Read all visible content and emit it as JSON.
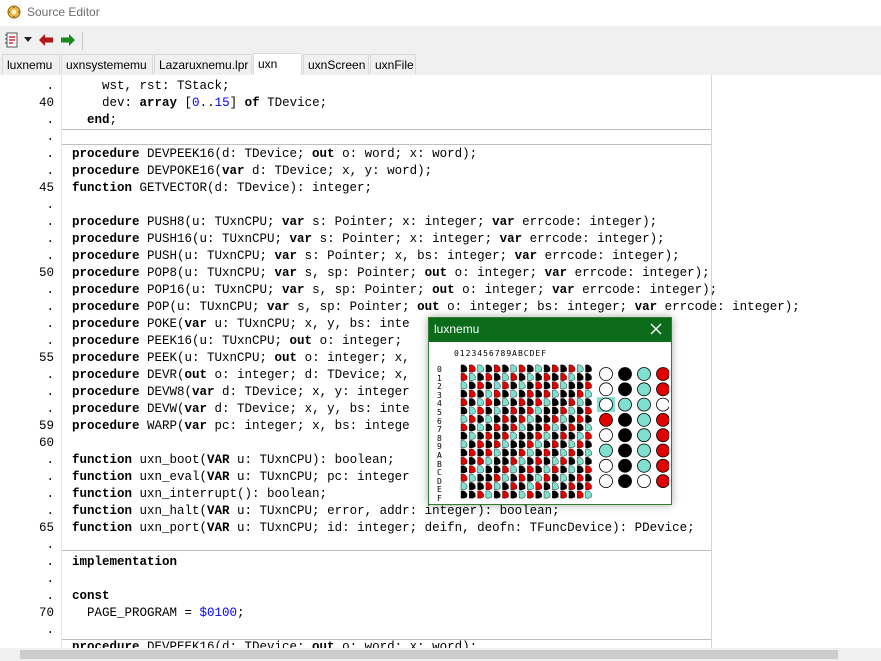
{
  "window": {
    "title": "Source Editor"
  },
  "toolbar": {
    "items": [
      "file-options-icon",
      "dropdown-icon",
      "back-icon",
      "forward-icon"
    ]
  },
  "tabs": [
    "luxnemu",
    "uxnsystememu",
    "Lazaruxnemu.lpr",
    "uxn",
    "uxnScreen",
    "uxnFile"
  ],
  "active_tab": "uxn",
  "editor": {
    "lines": [
      {
        "n": ".",
        "code": [
          [
            "    wst, rst: TStack;",
            ""
          ]
        ]
      },
      {
        "n": "40",
        "code": [
          [
            "    dev: ",
            ""
          ],
          [
            "array",
            "kw"
          ],
          [
            " [",
            ""
          ],
          [
            "0",
            "num"
          ],
          [
            "..",
            ""
          ],
          [
            "15",
            "num"
          ],
          [
            "] ",
            ""
          ],
          [
            "of",
            "kw"
          ],
          [
            " TDevice;",
            ""
          ]
        ]
      },
      {
        "n": ".",
        "code": [
          [
            "  ",
            ""
          ],
          [
            "end",
            "kw"
          ],
          [
            ";",
            ""
          ]
        ]
      },
      {
        "n": ".",
        "code": []
      },
      {
        "n": ".",
        "code": [
          [
            "procedure",
            "kw"
          ],
          [
            " DEVPEEK16(d: TDevice; ",
            ""
          ],
          [
            "out",
            "kw"
          ],
          [
            " o: word; x: word);",
            ""
          ]
        ]
      },
      {
        "n": ".",
        "code": [
          [
            "procedure",
            "kw"
          ],
          [
            " DEVPOKE16(",
            ""
          ],
          [
            "var",
            "kw"
          ],
          [
            " d: TDevice; x, y: word);",
            ""
          ]
        ]
      },
      {
        "n": "45",
        "code": [
          [
            "function",
            "kw"
          ],
          [
            " GETVECTOR(d: TDevice): integer;",
            ""
          ]
        ]
      },
      {
        "n": ".",
        "code": []
      },
      {
        "n": ".",
        "code": [
          [
            "procedure",
            "kw"
          ],
          [
            " PUSH8(u: TUxnCPU; ",
            ""
          ],
          [
            "var",
            "kw"
          ],
          [
            " s: Pointer; x: integer; ",
            ""
          ],
          [
            "var",
            "kw"
          ],
          [
            " errcode: integer);",
            ""
          ]
        ]
      },
      {
        "n": ".",
        "code": [
          [
            "procedure",
            "kw"
          ],
          [
            " PUSH16(u: TUxnCPU; ",
            ""
          ],
          [
            "var",
            "kw"
          ],
          [
            " s: Pointer; x: integer; ",
            ""
          ],
          [
            "var",
            "kw"
          ],
          [
            " errcode: integer);",
            ""
          ]
        ]
      },
      {
        "n": ".",
        "code": [
          [
            "procedure",
            "kw"
          ],
          [
            " PUSH(u: TUxnCPU; ",
            ""
          ],
          [
            "var",
            "kw"
          ],
          [
            " s: Pointer; x, bs: integer; ",
            ""
          ],
          [
            "var",
            "kw"
          ],
          [
            " errcode: integer);",
            ""
          ]
        ]
      },
      {
        "n": "50",
        "code": [
          [
            "procedure",
            "kw"
          ],
          [
            " POP8(u: TUxnCPU; ",
            ""
          ],
          [
            "var",
            "kw"
          ],
          [
            " s, sp: Pointer; ",
            ""
          ],
          [
            "out",
            "kw"
          ],
          [
            " o: integer; ",
            ""
          ],
          [
            "var",
            "kw"
          ],
          [
            " errcode: integer);",
            ""
          ]
        ]
      },
      {
        "n": ".",
        "code": [
          [
            "procedure",
            "kw"
          ],
          [
            " POP16(u: TUxnCPU; ",
            ""
          ],
          [
            "var",
            "kw"
          ],
          [
            " s, sp: Pointer; ",
            ""
          ],
          [
            "out",
            "kw"
          ],
          [
            " o: integer; ",
            ""
          ],
          [
            "var",
            "kw"
          ],
          [
            " errcode: integer);",
            ""
          ]
        ]
      },
      {
        "n": ".",
        "code": [
          [
            "procedure",
            "kw"
          ],
          [
            " POP(u: TUxnCPU; ",
            ""
          ],
          [
            "var",
            "kw"
          ],
          [
            " s, sp: Pointer; ",
            ""
          ],
          [
            "out",
            "kw"
          ],
          [
            " o: integer; bs: integer; ",
            ""
          ],
          [
            "var",
            "kw"
          ],
          [
            " errcode: integer);",
            ""
          ]
        ]
      },
      {
        "n": ".",
        "code": [
          [
            "procedure",
            "kw"
          ],
          [
            " POKE(",
            ""
          ],
          [
            "var",
            "kw"
          ],
          [
            " u: TUxnCPU; x, y, bs: inte",
            ""
          ]
        ]
      },
      {
        "n": ".",
        "code": [
          [
            "procedure",
            "kw"
          ],
          [
            " PEEK16(u: TUxnCPU; ",
            ""
          ],
          [
            "out",
            "kw"
          ],
          [
            " o: integer;",
            ""
          ]
        ]
      },
      {
        "n": "55",
        "code": [
          [
            "procedure",
            "kw"
          ],
          [
            " PEEK(u: TUxnCPU; ",
            ""
          ],
          [
            "out",
            "kw"
          ],
          [
            " o: integer; x,",
            ""
          ]
        ]
      },
      {
        "n": ".",
        "code": [
          [
            "procedure",
            "kw"
          ],
          [
            " DEVR(",
            ""
          ],
          [
            "out",
            "kw"
          ],
          [
            " o: integer; d: TDevice; x,",
            ""
          ]
        ]
      },
      {
        "n": ".",
        "code": [
          [
            "procedure",
            "kw"
          ],
          [
            " DEVW8(",
            ""
          ],
          [
            "var",
            "kw"
          ],
          [
            " d: TDevice; x, y: integer",
            ""
          ]
        ]
      },
      {
        "n": ".",
        "code": [
          [
            "procedure",
            "kw"
          ],
          [
            " DEVW(",
            ""
          ],
          [
            "var",
            "kw"
          ],
          [
            " d: TDevice; x, y, bs: inte",
            ""
          ]
        ]
      },
      {
        "n": "59",
        "code": [
          [
            "procedure",
            "kw"
          ],
          [
            " WARP(",
            ""
          ],
          [
            "var",
            "kw"
          ],
          [
            " pc: integer; x, bs: intege",
            ""
          ]
        ]
      },
      {
        "n": "60",
        "code": []
      },
      {
        "n": ".",
        "code": [
          [
            "function",
            "kw"
          ],
          [
            " uxn_boot(",
            ""
          ],
          [
            "VAR",
            "kw"
          ],
          [
            " u: TUxnCPU): boolean;",
            ""
          ]
        ]
      },
      {
        "n": ".",
        "code": [
          [
            "function",
            "kw"
          ],
          [
            " uxn_eval(",
            ""
          ],
          [
            "VAR",
            "kw"
          ],
          [
            " u: TUxnCPU; pc: integer",
            ""
          ]
        ]
      },
      {
        "n": ".",
        "code": [
          [
            "function",
            "kw"
          ],
          [
            " uxn_interrupt(): boolean;",
            ""
          ]
        ]
      },
      {
        "n": ".",
        "code": [
          [
            "function",
            "kw"
          ],
          [
            " uxn_halt(",
            ""
          ],
          [
            "VAR",
            "kw"
          ],
          [
            " u: TUxnCPU; error, addr: integer): boolean;",
            ""
          ]
        ]
      },
      {
        "n": "65",
        "code": [
          [
            "function",
            "kw"
          ],
          [
            " uxn_port(",
            ""
          ],
          [
            "VAR",
            "kw"
          ],
          [
            " u: TUxnCPU; id: integer; deifn, deofn: TFuncDevice): PDevice;",
            ""
          ]
        ]
      },
      {
        "n": ".",
        "code": []
      },
      {
        "n": ".",
        "code": [
          [
            "implementation",
            "kw"
          ]
        ]
      },
      {
        "n": ".",
        "code": []
      },
      {
        "n": ".",
        "code": [
          [
            "const",
            "kw"
          ]
        ]
      },
      {
        "n": "70",
        "code": [
          [
            "  PAGE_PROGRAM = ",
            ""
          ],
          [
            "$0100",
            "num"
          ],
          [
            ";",
            ""
          ]
        ]
      },
      {
        "n": ".",
        "code": []
      },
      {
        "n": ".",
        "code": [
          [
            "procedure",
            "kw"
          ],
          [
            " DEVPEEK16(d: TDevice; ",
            ""
          ],
          [
            "out",
            "kw"
          ],
          [
            " o: word; x: word);",
            ""
          ]
        ]
      }
    ]
  },
  "popup": {
    "title": "luxnemu",
    "hex_header": "0123456789ABCDEF",
    "hex_rows": "0123456789ABCDEF"
  },
  "colors": {
    "title_bar_popup": "#0b6b1a",
    "accent_red": "#e00000",
    "accent_teal": "#7fe0d0",
    "number_blue": "#0000ff"
  }
}
